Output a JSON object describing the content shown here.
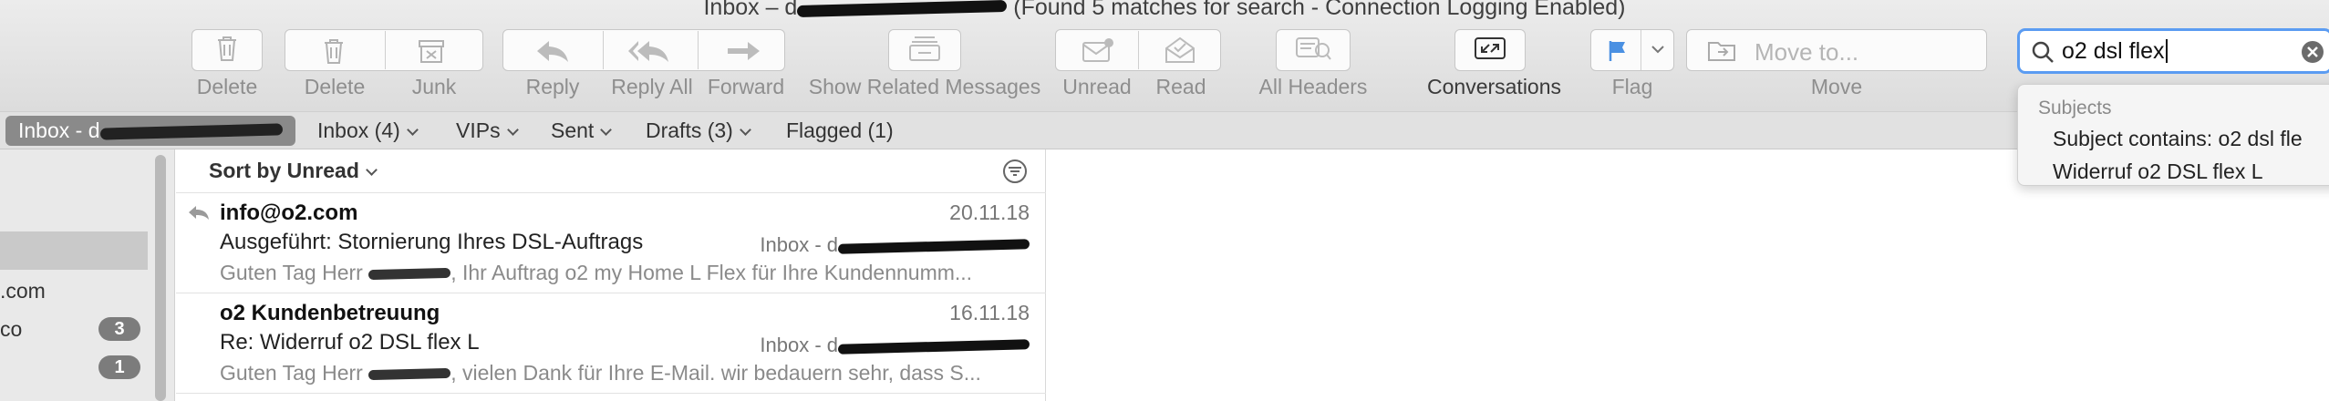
{
  "window": {
    "title_prefix": "Inbox – d",
    "title_suffix": " (Found 5 matches for search - Connection Logging Enabled)"
  },
  "toolbar": {
    "delete_label": "Delete",
    "delete2_label": "Delete",
    "junk_label": "Junk",
    "reply_label": "Reply",
    "reply_all_label": "Reply All",
    "forward_label": "Forward",
    "related_label": "Show Related Messages",
    "unread_label": "Unread",
    "read_label": "Read",
    "headers_label": "All Headers",
    "conversations_label": "Conversations",
    "flag_label": "Flag",
    "move_label": "Move",
    "move_placeholder": "Move to...",
    "flag_color": "#4a90e2"
  },
  "search": {
    "query": "o2 dsl flex",
    "suggestions_header": "Subjects",
    "suggestions": [
      "Subject contains: o2 dsl fle",
      "Widerruf o2 DSL flex L"
    ]
  },
  "favorites": {
    "inbox_account": "Inbox - d",
    "inbox": "Inbox (4)",
    "vips": "VIPs",
    "sent": "Sent",
    "drafts": "Drafts (3)",
    "flagged": "Flagged (1)"
  },
  "sidebar": {
    "items": [
      {
        "label": ".com"
      },
      {
        "label": "co",
        "badge": "3"
      },
      {
        "label": "",
        "badge": "1"
      }
    ]
  },
  "message_list": {
    "sort_label": "Sort by Unread",
    "messages": [
      {
        "from": "info@o2.com",
        "date": "20.11.18",
        "subject": "Ausgeführt: Stornierung Ihres DSL-Auftrags",
        "mailbox": "Inbox - d",
        "preview_a": "Guten Tag Herr ",
        "preview_b": ", Ihr Auftrag o2 my Home L Flex für Ihre Kundennumm...",
        "replied": true
      },
      {
        "from": "o2 Kundenbetreuung",
        "date": "16.11.18",
        "subject": "Re: Widerruf o2 DSL flex L",
        "mailbox": "Inbox - d",
        "preview_a": "Guten Tag Herr ",
        "preview_b": ", vielen Dank für Ihre E-Mail. wir bedauern sehr, dass S...",
        "replied": false
      }
    ]
  }
}
